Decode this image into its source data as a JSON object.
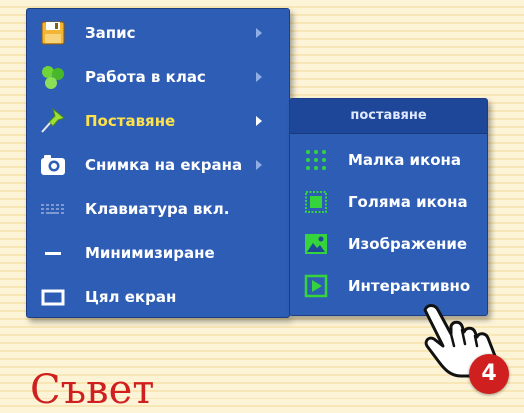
{
  "menu": {
    "items": [
      {
        "label": "Запис",
        "icon": "save-icon"
      },
      {
        "label": "Работа в клас",
        "icon": "group-icon"
      },
      {
        "label": "Поставяне",
        "icon": "pin-icon"
      },
      {
        "label": "Снимка на екрана",
        "icon": "camera-icon"
      },
      {
        "label": "Клавиатура вкл.",
        "icon": "keyboard-icon"
      },
      {
        "label": "Минимизиране",
        "icon": "minimize-icon"
      },
      {
        "label": "Цял екран",
        "icon": "fullscreen-icon"
      }
    ],
    "active_index": 2
  },
  "submenu": {
    "title": "поставяне",
    "items": [
      {
        "label": "Малка икона",
        "icon": "small-icon-grid-icon"
      },
      {
        "label": "Голяма икона",
        "icon": "large-icon-frame-icon"
      },
      {
        "label": "Изображение",
        "icon": "image-icon"
      },
      {
        "label": "Интерактивно",
        "icon": "play-icon"
      }
    ]
  },
  "step_badge": "4",
  "caption": "Съвет",
  "colors": {
    "menu_bg": "#2e5db5",
    "submenu_header": "#1f4799",
    "active_text": "#ffe24a",
    "accent_green": "#35d43c",
    "badge": "#cf1f1f"
  }
}
